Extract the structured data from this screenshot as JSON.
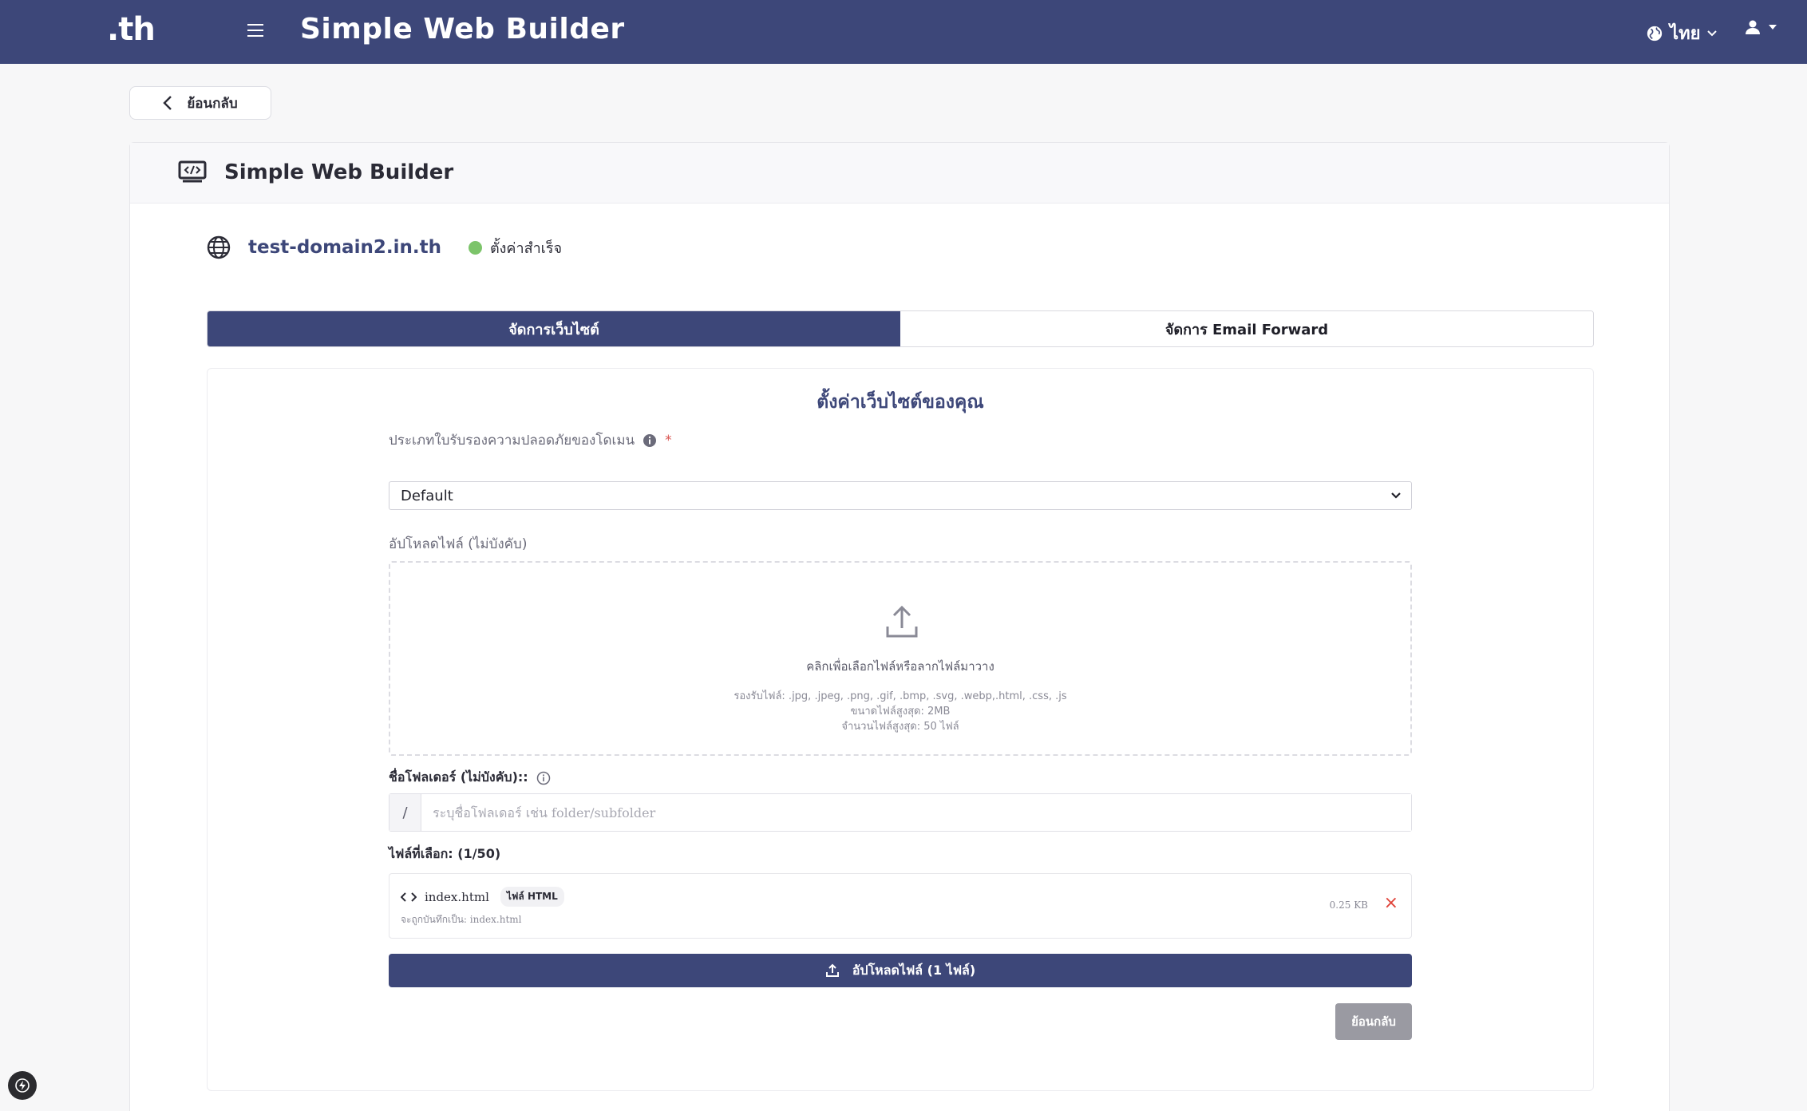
{
  "navbar": {
    "logo": ".th",
    "app_title": "Simple Web Builder",
    "language": "ไทย"
  },
  "back_button_label": "ย้อนกลับ",
  "card": {
    "title": "Simple Web Builder"
  },
  "domain": {
    "name": "test-domain2.in.th",
    "status": "ตั้งค่าสำเร็จ",
    "status_color": "#7cc46a"
  },
  "tabs": [
    {
      "label": "จัดการเว็บไซต์",
      "active": true
    },
    {
      "label": "จัดการ Email Forward",
      "active": false
    }
  ],
  "form": {
    "section_title": "ตั้งค่าเว็บไซต์ของคุณ",
    "certificate_label": "ประเภทใบรับรองความปลอดภัยของโดเมน",
    "certificate_required_mark": "*",
    "certificate_value": "Default",
    "upload_label": "อัปโหลดไฟล์ (ไม่บังคับ)",
    "dropzone": {
      "text": "คลิกเพื่อเลือกไฟล์หรือลากไฟล์มาวาง",
      "supported": "รองรับไฟล์: .jpg, .jpeg, .png, .gif, .bmp, .svg, .webp,.html, .css, .js",
      "max_size": "ขนาดไฟล์สูงสุด: 2MB",
      "max_files": "จำนวนไฟล์สูงสุด: 50 ไฟล์"
    },
    "folder_label": "ชื่อโฟลเดอร์ (ไม่บังคับ)::",
    "folder_prefix": "/",
    "folder_placeholder": "ระบุชื่อโฟลเดอร์ เช่น folder/subfolder",
    "folder_value": "",
    "selected_files_label": "ไฟล์ที่เลือก: (1/50)",
    "files": [
      {
        "name": "index.html",
        "type_badge": "ไฟล์ HTML",
        "save_as": "จะถูกบันทึกเป็น: index.html",
        "size": "0.25 KB",
        "remove": "×"
      }
    ],
    "upload_button": "อัปโหลดไฟล์ (1 ไฟล์)",
    "back_button": "ย้อนกลับ"
  },
  "colors": {
    "brand": "#3d4779",
    "danger": "#e0443a",
    "muted_button": "#9a9aa2"
  }
}
